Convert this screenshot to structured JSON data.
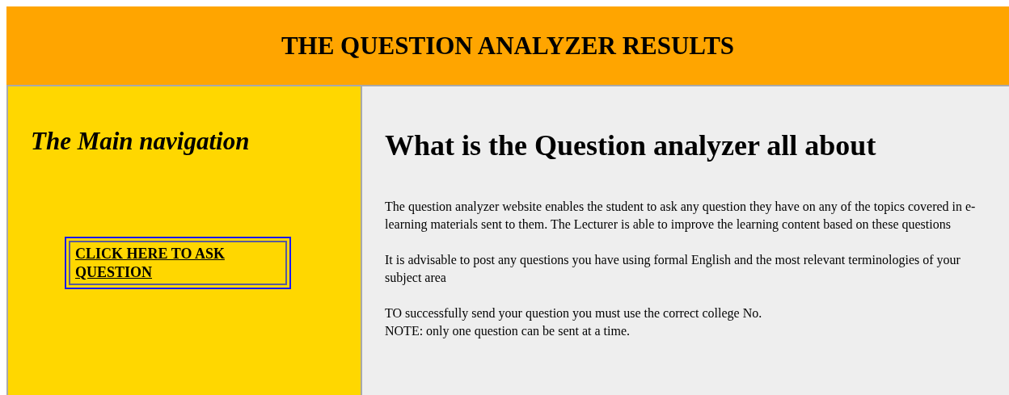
{
  "header": {
    "title": "THE QUESTION ANALYZER RESULTS"
  },
  "sidebar": {
    "heading": "The Main navigation",
    "link": "CLICK HERE TO ASK QUESTION"
  },
  "main": {
    "heading": "What is the Question analyzer all about",
    "paragraphs": [
      [
        "The question analyzer website enables the student to ask any question they have on any of the topics covered in e-learning materials sent to them. The Lecturer is able to improve the learning content based on these questions"
      ],
      [
        "It is advisable to post any questions you have using formal English and the most relevant terminologies of your subject area"
      ],
      [
        "TO successfully send your question you must use the correct college No.",
        "NOTE: only one question can be sent at a time."
      ]
    ]
  }
}
